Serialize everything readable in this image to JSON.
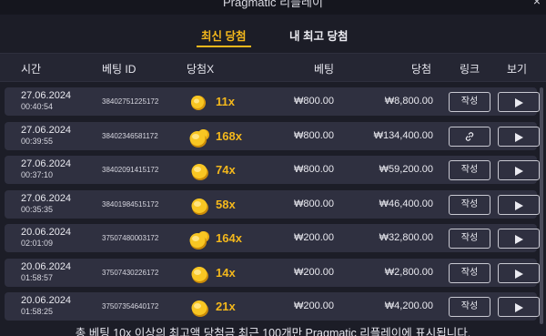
{
  "window": {
    "title": "Pragmatic 리플레이",
    "close_glyph": "×"
  },
  "tabs": {
    "latest": "최신 당첨",
    "my_best": "내 최고 당첨"
  },
  "columns": {
    "time": "시간",
    "bet_id": "베팅 ID",
    "multiplier": "당첨X",
    "bet": "베팅",
    "win": "당첨",
    "link": "링크",
    "view": "보기"
  },
  "rows": [
    {
      "date": "27.06.2024",
      "time": "00:40:54",
      "bet_id": "38402751225172",
      "multiplier": "11x",
      "coins": "small",
      "bet": "₩800.00",
      "win": "₩8,800.00",
      "link": "작성",
      "link_type": "text"
    },
    {
      "date": "27.06.2024",
      "time": "00:39:55",
      "bet_id": "38402346581172",
      "multiplier": "168x",
      "coins": "large",
      "bet": "₩800.00",
      "win": "₩134,400.00",
      "link": "",
      "link_type": "icon"
    },
    {
      "date": "27.06.2024",
      "time": "00:37:10",
      "bet_id": "38402091415172",
      "multiplier": "74x",
      "coins": "medium",
      "bet": "₩800.00",
      "win": "₩59,200.00",
      "link": "작성",
      "link_type": "text"
    },
    {
      "date": "27.06.2024",
      "time": "00:35:35",
      "bet_id": "38401984515172",
      "multiplier": "58x",
      "coins": "medium",
      "bet": "₩800.00",
      "win": "₩46,400.00",
      "link": "작성",
      "link_type": "text"
    },
    {
      "date": "20.06.2024",
      "time": "02:01:09",
      "bet_id": "37507480003172",
      "multiplier": "164x",
      "coins": "large",
      "bet": "₩200.00",
      "win": "₩32,800.00",
      "link": "작성",
      "link_type": "text"
    },
    {
      "date": "20.06.2024",
      "time": "01:58:57",
      "bet_id": "37507430226172",
      "multiplier": "14x",
      "coins": "medium",
      "bet": "₩200.00",
      "win": "₩2,800.00",
      "link": "작성",
      "link_type": "text"
    },
    {
      "date": "20.06.2024",
      "time": "01:58:25",
      "bet_id": "37507354640172",
      "multiplier": "21x",
      "coins": "medium",
      "bet": "₩200.00",
      "win": "₩4,200.00",
      "link": "작성",
      "link_type": "text"
    }
  ],
  "footer": {
    "note": "총 베팅 10x 이상의 최고액 당첨금 최근 100개만 Pragmatic 리플레이에 표시됩니다."
  },
  "colors": {
    "accent": "#f4b81c",
    "background": "#1c1d27",
    "row": "#2f3040"
  }
}
